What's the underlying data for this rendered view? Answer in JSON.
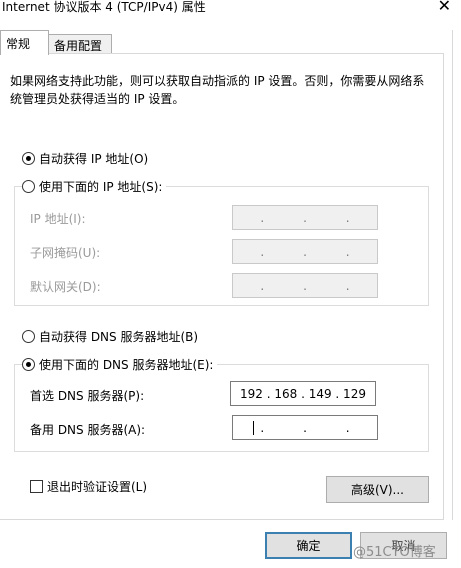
{
  "window": {
    "title": "Internet 协议版本 4 (TCP/IPv4) 属性",
    "close_glyph": "✕"
  },
  "tabs": [
    {
      "label": "常规",
      "active": true
    },
    {
      "label": "备用配置",
      "active": false
    }
  ],
  "description": "如果网络支持此功能，则可以获取自动指派的 IP 设置。否则，你需要从网络系统管理员处获得适当的 IP 设置。",
  "ip_section": {
    "auto_label": "自动获得 IP 地址(O)",
    "manual_label": "使用下面的 IP 地址(S):",
    "auto_checked": true,
    "fields": [
      {
        "label": "IP 地址(I):",
        "value": ""
      },
      {
        "label": "子网掩码(U):",
        "value": ""
      },
      {
        "label": "默认网关(D):",
        "value": ""
      }
    ]
  },
  "dns_section": {
    "auto_label": "自动获得 DNS 服务器地址(B)",
    "manual_label": "使用下面的 DNS 服务器地址(E):",
    "manual_checked": true,
    "preferred": {
      "label": "首选 DNS 服务器(P):",
      "value": "192 . 168 . 149 . 129"
    },
    "alternate": {
      "label": "备用 DNS 服务器(A):",
      "value": ""
    }
  },
  "validate_label": "退出时验证设置(L)",
  "buttons": {
    "advanced": "高级(V)...",
    "ok": "确定",
    "cancel": "取消"
  },
  "watermark": "@51CTO博客",
  "dot": "."
}
